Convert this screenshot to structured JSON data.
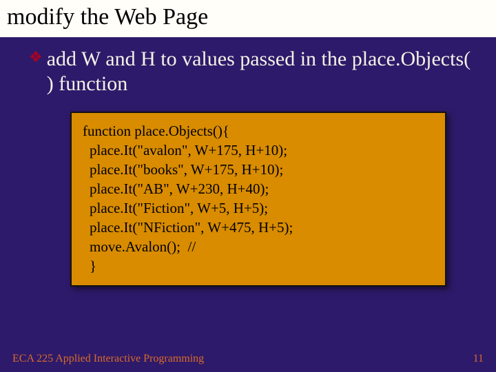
{
  "title": "modify the Web Page",
  "bullet": "add W and H to values passed in the place.Objects( ) function",
  "code": {
    "l1": "function place.Objects(){",
    "l2": "place.It(\"avalon\", W+175, H+10);",
    "l3": "place.It(\"books\", W+175, H+10);",
    "l4": "place.It(\"AB\", W+230, H+40);",
    "l5": "place.It(\"Fiction\", W+5, H+5);",
    "l6": "place.It(\"NFiction\", W+475, H+5);",
    "l7": "move.Avalon();  //",
    "l8": "}"
  },
  "footer": {
    "course": "ECA 225   Applied Interactive Programming",
    "page": "11"
  }
}
